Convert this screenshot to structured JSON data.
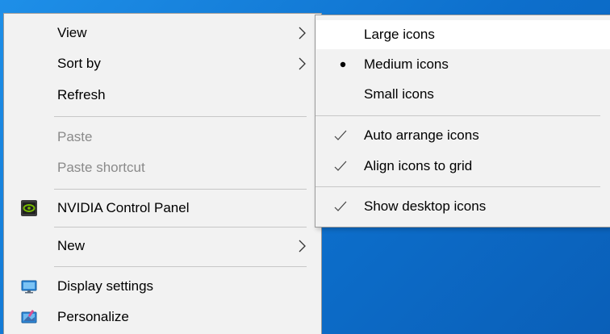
{
  "main_menu": {
    "items": [
      {
        "label": "View",
        "submenu": true
      },
      {
        "label": "Sort by",
        "submenu": true
      },
      {
        "label": "Refresh"
      },
      {
        "label": "Paste",
        "disabled": true
      },
      {
        "label": "Paste shortcut",
        "disabled": true
      },
      {
        "label": "NVIDIA Control Panel",
        "icon": "nvidia-icon"
      },
      {
        "label": "New",
        "submenu": true
      },
      {
        "label": "Display settings",
        "icon": "display-settings-icon"
      },
      {
        "label": "Personalize",
        "icon": "personalize-icon"
      }
    ]
  },
  "view_submenu": {
    "items": [
      {
        "label": "Large icons",
        "highlighted": true
      },
      {
        "label": "Medium icons",
        "mark": "bullet"
      },
      {
        "label": "Small icons"
      },
      {
        "label": "Auto arrange icons",
        "mark": "check"
      },
      {
        "label": "Align icons to grid",
        "mark": "check"
      },
      {
        "label": "Show desktop icons",
        "mark": "check"
      }
    ]
  },
  "colors": {
    "menu_background": "#f2f2f2",
    "menu_border": "#9a9a9a",
    "disabled_text": "#8a8a8a",
    "desktop_accent": "#1a7fd9",
    "nvidia_green": "#76b900"
  }
}
